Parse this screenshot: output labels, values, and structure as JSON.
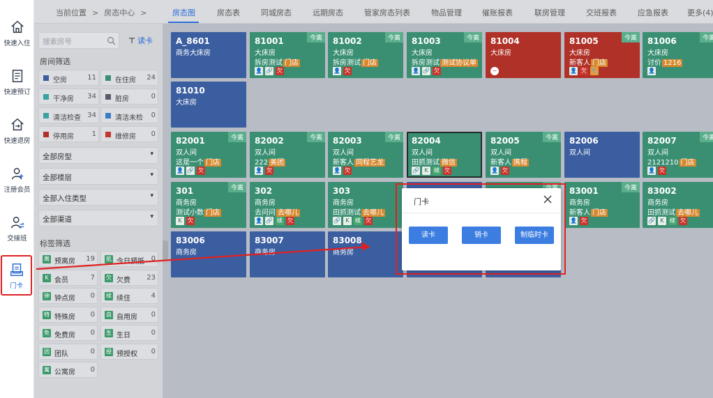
{
  "nav": {
    "items": [
      {
        "label": "快速入住",
        "icon": "home-icon"
      },
      {
        "label": "快速预订",
        "icon": "document-icon"
      },
      {
        "label": "快速退房",
        "icon": "checkout-icon"
      },
      {
        "label": "注册会员",
        "icon": "add-user-icon"
      },
      {
        "label": "交接班",
        "icon": "shift-user-icon"
      },
      {
        "label": "门卡",
        "icon": "card-icon"
      }
    ]
  },
  "breadcrumb": {
    "prefix": "当前位置",
    "sep": ">",
    "current": "房态中心",
    "sep2": ">"
  },
  "tabs": [
    "房态图",
    "房态表",
    "同城房态",
    "远期房态",
    "管家房态列表",
    "物品管理",
    "催账报表",
    "联房管理",
    "交班报表",
    "应急报表",
    "更多(4)"
  ],
  "active_tab": "房态图",
  "sidebar": {
    "search_placeholder": "搜索房号",
    "read_card": "读卡",
    "room_filter_title": "房间筛选",
    "room_filters": [
      {
        "label": "空房",
        "count": "11",
        "color": "#3b5ea0"
      },
      {
        "label": "在住房",
        "count": "24",
        "color": "#3a8f73"
      },
      {
        "label": "干净房",
        "count": "34",
        "color": "#3aa2a0"
      },
      {
        "label": "脏房",
        "count": "0",
        "color": "#555b66"
      },
      {
        "label": "清洁检查",
        "count": "34",
        "color": "#3aa2a0"
      },
      {
        "label": "清洁未检",
        "count": "0",
        "color": "#3b7cc4"
      },
      {
        "label": "停用房",
        "count": "1",
        "color": "#b03127"
      },
      {
        "label": "维修房",
        "count": "0",
        "color": "#c0392b"
      }
    ],
    "dropdowns": [
      "全部房型",
      "全部楼层",
      "全部入住类型",
      "全部渠道"
    ],
    "tag_filter_title": "标签筛选",
    "tag_filters": [
      {
        "label": "预离房",
        "count": "19",
        "icon": "离"
      },
      {
        "label": "今日预抵",
        "count": "0",
        "icon": "抵"
      },
      {
        "label": "会员",
        "count": "7",
        "icon": "K"
      },
      {
        "label": "欠费",
        "count": "23",
        "icon": "欠"
      },
      {
        "label": "钟点房",
        "count": "0",
        "icon": "钟"
      },
      {
        "label": "续住",
        "count": "4",
        "icon": "续"
      },
      {
        "label": "特殊房",
        "count": "0",
        "icon": "特"
      },
      {
        "label": "自用房",
        "count": "0",
        "icon": "自"
      },
      {
        "label": "免费房",
        "count": "0",
        "icon": "免"
      },
      {
        "label": "生日",
        "count": "0",
        "icon": "生"
      },
      {
        "label": "团队",
        "count": "0",
        "icon": "团"
      },
      {
        "label": "预授权",
        "count": "0",
        "icon": "授"
      },
      {
        "label": "公寓房",
        "count": "0",
        "icon": "寓"
      }
    ]
  },
  "rooms": [
    {
      "num": "A_8601",
      "type": "商务大床房",
      "status": "blue"
    },
    {
      "num": "81001",
      "type": "大床房",
      "guest": "拆房测试",
      "source": "门店",
      "corner": "今离",
      "status": "green",
      "icons": [
        "user",
        "link",
        "欠"
      ]
    },
    {
      "num": "81002",
      "type": "大床房",
      "guest": "拆房测试",
      "source": "门店",
      "corner": "今离",
      "status": "green",
      "icons": [
        "user",
        "欠"
      ]
    },
    {
      "num": "81003",
      "type": "大床房",
      "guest": "拆房测试",
      "source": "测试协议单",
      "corner": "今离",
      "status": "green",
      "icons": [
        "user",
        "link",
        "欠"
      ]
    },
    {
      "num": "81004",
      "type": "大床房",
      "status": "red",
      "icons": [
        "minus"
      ]
    },
    {
      "num": "81005",
      "type": "大床房",
      "guest": "新客人",
      "source": "门店",
      "corner": "今离",
      "status": "red",
      "icons": [
        "user",
        "欠",
        "wrench"
      ]
    },
    {
      "num": "81006",
      "type": "大床房",
      "guest": "讨价",
      "source": "1216",
      "corner": "今离",
      "status": "green",
      "icons": [
        "user"
      ]
    },
    {
      "num": "81010",
      "type": "大床房",
      "status": "blue"
    },
    {
      "num": "82001",
      "type": "双人间",
      "guest": "这是一个",
      "source": "门店",
      "corner": "今离",
      "status": "green",
      "icons": [
        "user",
        "link",
        "欠"
      ]
    },
    {
      "num": "82002",
      "type": "双人间",
      "guest": "222",
      "source": "美团",
      "corner": "今离",
      "status": "green",
      "icons": [
        "user",
        "欠"
      ]
    },
    {
      "num": "82003",
      "type": "双人间",
      "guest": "新客人",
      "source": "同程艺龙",
      "corner": "今离",
      "status": "green",
      "icons": [
        "user",
        "欠"
      ]
    },
    {
      "num": "82004",
      "type": "双人间",
      "guest": "田抓测试",
      "source": "微信",
      "status": "green",
      "sel": true,
      "icons": [
        "link",
        "K",
        "续",
        "欠"
      ]
    },
    {
      "num": "82005",
      "type": "双人间",
      "guest": "新客人",
      "source": "携程",
      "corner": "今离",
      "status": "green",
      "icons": [
        "user",
        "欠"
      ]
    },
    {
      "num": "82006",
      "type": "双人间",
      "status": "blue"
    },
    {
      "num": "82007",
      "type": "双人间",
      "guest": "2121210",
      "source": "门店",
      "corner": "今离",
      "status": "green",
      "icons": [
        "user",
        "欠"
      ]
    },
    {
      "num": "301",
      "type": "商务房",
      "guest": "测试小数",
      "source": "门店",
      "corner": "今离",
      "status": "green",
      "icons": [
        "K",
        "欠"
      ]
    },
    {
      "num": "302",
      "type": "商务房",
      "guest": "去问问",
      "source": "去哪儿",
      "status": "green",
      "icons": [
        "user",
        "link",
        "续",
        "欠"
      ]
    },
    {
      "num": "303",
      "type": "商务房",
      "guest": "田抓测试",
      "source": "去哪儿",
      "status": "green",
      "icons": [
        "link",
        "K",
        "续",
        "欠"
      ]
    },
    {
      "num": "",
      "type": "",
      "status": "blue"
    },
    {
      "num": "",
      "type": "",
      "status": "green",
      "corner": "今离"
    },
    {
      "num": "83001",
      "type": "商务房",
      "guest": "新客人",
      "source": "门店",
      "corner": "今离",
      "status": "green",
      "icons": [
        "user",
        "欠"
      ]
    },
    {
      "num": "83002",
      "type": "商务房",
      "guest": "田抓测试",
      "source": "去哪儿",
      "status": "green",
      "icons": [
        "link",
        "K",
        "续",
        "欠"
      ]
    },
    {
      "num": "83006",
      "type": "商务房",
      "status": "blue"
    },
    {
      "num": "83007",
      "type": "商务房",
      "status": "blue"
    },
    {
      "num": "83008",
      "type": "商务房",
      "status": "blue"
    },
    {
      "num": "",
      "type": "",
      "status": "blue"
    },
    {
      "num": "",
      "type": "",
      "status": "blue"
    }
  ],
  "modal": {
    "title": "门卡",
    "buttons": [
      "读卡",
      "销卡",
      "制临时卡"
    ]
  },
  "colors": {
    "accent": "#2a6cd6",
    "highlight": "#e02020"
  }
}
